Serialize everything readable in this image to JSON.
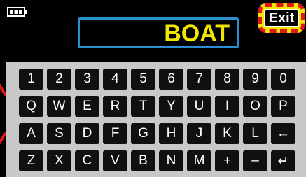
{
  "battery_icon": "battery-icon",
  "entry": {
    "text": "BOAT"
  },
  "exit": {
    "label": "Exit"
  },
  "keyboard": {
    "rows": [
      [
        "1",
        "2",
        "3",
        "4",
        "5",
        "6",
        "7",
        "8",
        "9",
        "0"
      ],
      [
        "Q",
        "W",
        "E",
        "R",
        "T",
        "Y",
        "U",
        "I",
        "O",
        "P"
      ],
      [
        "A",
        "S",
        "D",
        "F",
        "G",
        "H",
        "J",
        "K",
        "L",
        "←"
      ],
      [
        "Z",
        "X",
        "C",
        "V",
        "B",
        "N",
        "M",
        "+",
        "–",
        "↵"
      ]
    ]
  },
  "colors": {
    "entry_text": "#f2e600",
    "entry_border": "#2a90d0",
    "highlight_dash": "#e01818",
    "highlight_fill": "#f2e600",
    "key_bg": "#101010",
    "keyboard_bg": "#c8c8c8"
  }
}
